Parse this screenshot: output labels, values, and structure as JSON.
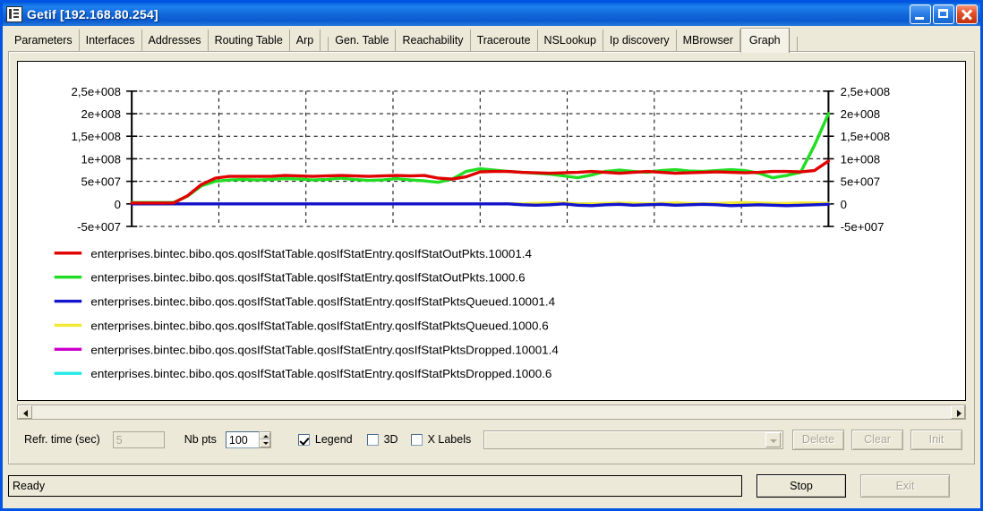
{
  "window": {
    "title": "Getif [192.168.80.254]",
    "icon": "app-icon",
    "buttons": {
      "minimize": "minimize",
      "maximize": "maximize",
      "close": "close"
    }
  },
  "tabs": [
    {
      "label": "Parameters",
      "selected": false
    },
    {
      "label": "Interfaces",
      "selected": false
    },
    {
      "label": "Addresses",
      "selected": false
    },
    {
      "label": "Routing Table",
      "selected": false
    },
    {
      "label": "Arp",
      "selected": false
    },
    {
      "label": "Gen. Table",
      "selected": false
    },
    {
      "label": "Reachability",
      "selected": false
    },
    {
      "label": "Traceroute",
      "selected": false
    },
    {
      "label": "NSLookup",
      "selected": false
    },
    {
      "label": "Ip discovery",
      "selected": false
    },
    {
      "label": "MBrowser",
      "selected": false
    },
    {
      "label": "Graph",
      "selected": true
    }
  ],
  "controls": {
    "refresh_label": "Refr. time (sec)",
    "refresh_value": "5",
    "nbpts_label": "Nb pts",
    "nbpts_value": "100",
    "legend_label": "Legend",
    "legend_checked": true,
    "threed_label": "3D",
    "threed_checked": false,
    "xlabels_label": "X Labels",
    "xlabels_checked": false,
    "combo_value": "",
    "delete_label": "Delete",
    "clear_label": "Clear",
    "init_label": "Init"
  },
  "statusbar": {
    "status_text": "Ready",
    "stop_label": "Stop",
    "exit_label": "Exit"
  },
  "chart_data": {
    "type": "line",
    "title": "",
    "xlabel": "",
    "ylabel": "",
    "grid": true,
    "legend_position": "below",
    "ylim": [
      -50000000,
      250000000
    ],
    "yticks": [
      250000000,
      200000000,
      150000000,
      100000000,
      50000000,
      0,
      -50000000
    ],
    "ytick_labels": [
      "2,5e+008",
      "2e+008",
      "1,5e+008",
      "1e+008",
      "5e+007",
      "0",
      "-5e+007"
    ],
    "right_axis_labels": [
      "2,5e+008",
      "2e+008",
      "1,5e+008",
      "1e+008",
      "5e+007",
      "0",
      "-5e+007"
    ],
    "x": [
      0,
      1,
      2,
      3,
      4,
      5,
      6,
      7,
      8,
      9,
      10,
      11,
      12,
      13,
      14,
      15,
      16,
      17,
      18,
      19,
      20,
      21,
      22,
      23,
      24,
      25,
      26,
      27,
      28,
      29,
      30,
      31,
      32,
      33,
      34,
      35,
      36,
      37,
      38,
      39,
      40,
      41,
      42,
      43,
      44,
      45,
      46,
      47,
      48,
      49,
      50
    ],
    "series": [
      {
        "name": "enterprises.bintec.bibo.qos.qosIfStatTable.qosIfStatEntry.qosIfStatOutPkts.10001.4",
        "color": "#e00000",
        "values": [
          2000000,
          2000000,
          2000000,
          2000000,
          18000000,
          43000000,
          57000000,
          61000000,
          61000000,
          61000000,
          61000000,
          63000000,
          62000000,
          61000000,
          62000000,
          63000000,
          62000000,
          61000000,
          62000000,
          63000000,
          62000000,
          63000000,
          57000000,
          55000000,
          60000000,
          71000000,
          72000000,
          72000000,
          70000000,
          69000000,
          68000000,
          69000000,
          70000000,
          72000000,
          70000000,
          68000000,
          70000000,
          72000000,
          70000000,
          68000000,
          69000000,
          70000000,
          71000000,
          70000000,
          69000000,
          70000000,
          72000000,
          72000000,
          71000000,
          74000000,
          95000000
        ]
      },
      {
        "name": "enterprises.bintec.bibo.qos.qosIfStatTable.qosIfStatEntry.qosIfStatOutPkts.1000.6",
        "color": "#22dd22",
        "values": [
          3000000,
          3000000,
          3000000,
          3000000,
          17000000,
          40000000,
          50000000,
          53000000,
          54000000,
          53000000,
          54000000,
          56000000,
          55000000,
          53000000,
          54000000,
          57000000,
          54000000,
          52000000,
          53000000,
          56000000,
          53000000,
          51000000,
          48000000,
          55000000,
          72000000,
          78000000,
          75000000,
          72000000,
          70000000,
          68000000,
          66000000,
          62000000,
          58000000,
          64000000,
          72000000,
          75000000,
          72000000,
          70000000,
          74000000,
          76000000,
          73000000,
          72000000,
          74000000,
          76000000,
          74000000,
          68000000,
          58000000,
          63000000,
          70000000,
          130000000,
          200000000
        ]
      },
      {
        "name": "enterprises.bintec.bibo.qos.qosIfStatTable.qosIfStatEntry.qosIfStatPktsQueued.10001.4",
        "color": "#1414cc",
        "values": [
          0,
          0,
          0,
          0,
          0,
          0,
          0,
          0,
          0,
          0,
          0,
          0,
          0,
          0,
          0,
          0,
          0,
          0,
          0,
          0,
          0,
          0,
          0,
          0,
          0,
          0,
          0,
          0,
          -2000000,
          -3000000,
          -2000000,
          0,
          -3000000,
          -4000000,
          -2000000,
          -1000000,
          -3000000,
          -2000000,
          -1000000,
          -3000000,
          -2000000,
          -1000000,
          -2000000,
          -4000000,
          -3000000,
          -2000000,
          -3000000,
          -4000000,
          -3000000,
          -2000000,
          -1000000
        ]
      },
      {
        "name": "enterprises.bintec.bibo.qos.qosIfStatTable.qosIfStatEntry.qosIfStatPktsQueued.1000.6",
        "color": "#f2e832",
        "values": [
          0,
          0,
          0,
          0,
          0,
          0,
          0,
          0,
          0,
          0,
          0,
          0,
          0,
          0,
          0,
          0,
          0,
          0,
          0,
          0,
          0,
          0,
          0,
          0,
          0,
          0,
          0,
          0,
          0,
          1000000,
          2000000,
          2000000,
          0,
          0,
          1000000,
          2000000,
          1000000,
          0,
          1000000,
          2000000,
          1000000,
          0,
          1000000,
          2000000,
          3000000,
          2000000,
          1000000,
          1000000,
          2000000,
          2000000,
          1000000
        ]
      },
      {
        "name": "enterprises.bintec.bibo.qos.qosIfStatTable.qosIfStatEntry.qosIfStatPktsDropped.10001.4",
        "color": "#cc00cc",
        "values": [
          0,
          0,
          0,
          0,
          0,
          0,
          0,
          0,
          0,
          0,
          0,
          0,
          0,
          0,
          0,
          0,
          0,
          0,
          0,
          0,
          0,
          0,
          0,
          0,
          0,
          0,
          0,
          0,
          0,
          0,
          0,
          0,
          0,
          0,
          0,
          0,
          0,
          0,
          0,
          0,
          0,
          0,
          0,
          0,
          0,
          0,
          0,
          0,
          0,
          0,
          0
        ]
      },
      {
        "name": "enterprises.bintec.bibo.qos.qosIfStatTable.qosIfStatEntry.qosIfStatPktsDropped.1000.6",
        "color": "#22e8e8",
        "values": [
          0,
          0,
          0,
          0,
          0,
          0,
          0,
          0,
          0,
          0,
          0,
          0,
          0,
          0,
          0,
          0,
          0,
          0,
          0,
          0,
          0,
          0,
          0,
          0,
          0,
          0,
          0,
          0,
          0,
          0,
          0,
          0,
          0,
          0,
          0,
          0,
          0,
          0,
          0,
          0,
          0,
          0,
          0,
          0,
          0,
          0,
          0,
          0,
          0,
          0,
          0
        ]
      }
    ]
  }
}
